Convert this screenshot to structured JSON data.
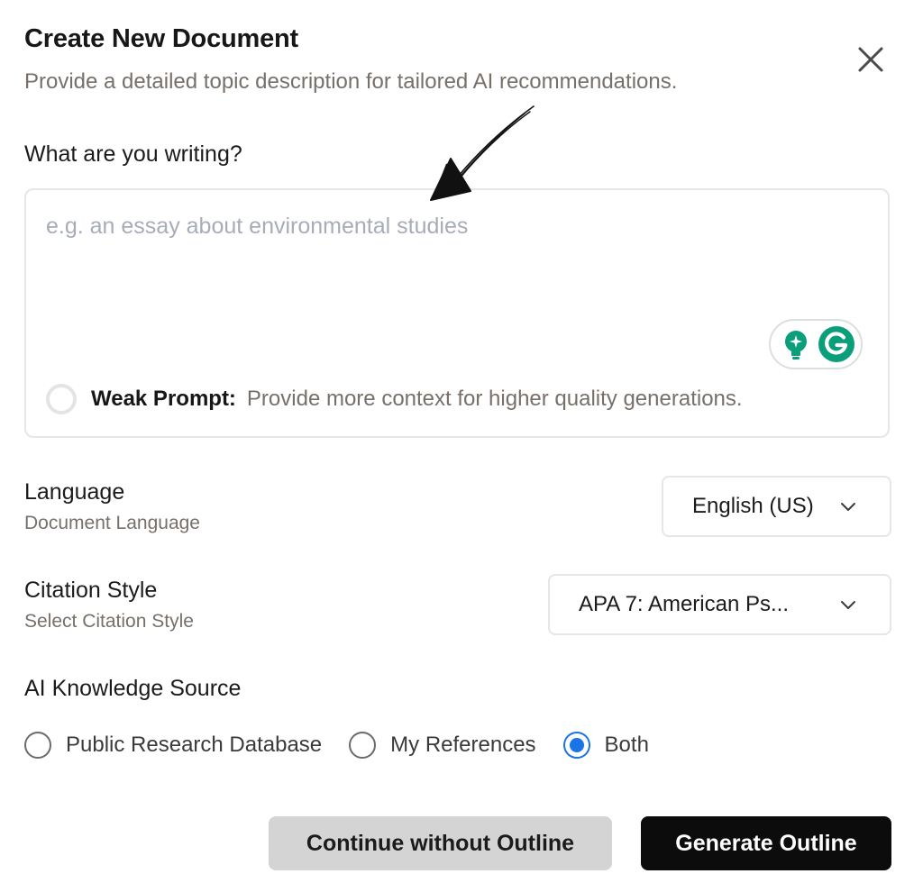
{
  "dialog": {
    "title": "Create New Document",
    "subtitle": "Provide a detailed topic description for tailored AI recommendations.",
    "close_icon": "close-icon"
  },
  "prompt": {
    "label": "What are you writing?",
    "value": "",
    "placeholder": "e.g. an essay about environmental studies",
    "strength_label": "Weak Prompt:",
    "strength_message": "Provide more context for higher quality generations.",
    "extension_icons": [
      "lightbulb-sparkle-icon",
      "grammarly-g-icon"
    ],
    "extension_color": "#0a9e7b"
  },
  "language": {
    "label": "Language",
    "sublabel": "Document Language",
    "selected": "English (US)"
  },
  "citation": {
    "label": "Citation Style",
    "sublabel": "Select Citation Style",
    "selected": "APA 7: American Ps..."
  },
  "knowledge_source": {
    "label": "AI Knowledge Source",
    "options": [
      {
        "label": "Public Research Database",
        "checked": false
      },
      {
        "label": "My References",
        "checked": false
      },
      {
        "label": "Both",
        "checked": true
      }
    ],
    "accent_color": "#1a73e8"
  },
  "actions": {
    "secondary_label": "Continue without Outline",
    "primary_label": "Generate Outline"
  },
  "annotation": {
    "icon": "hand-drawn-arrow-icon"
  }
}
